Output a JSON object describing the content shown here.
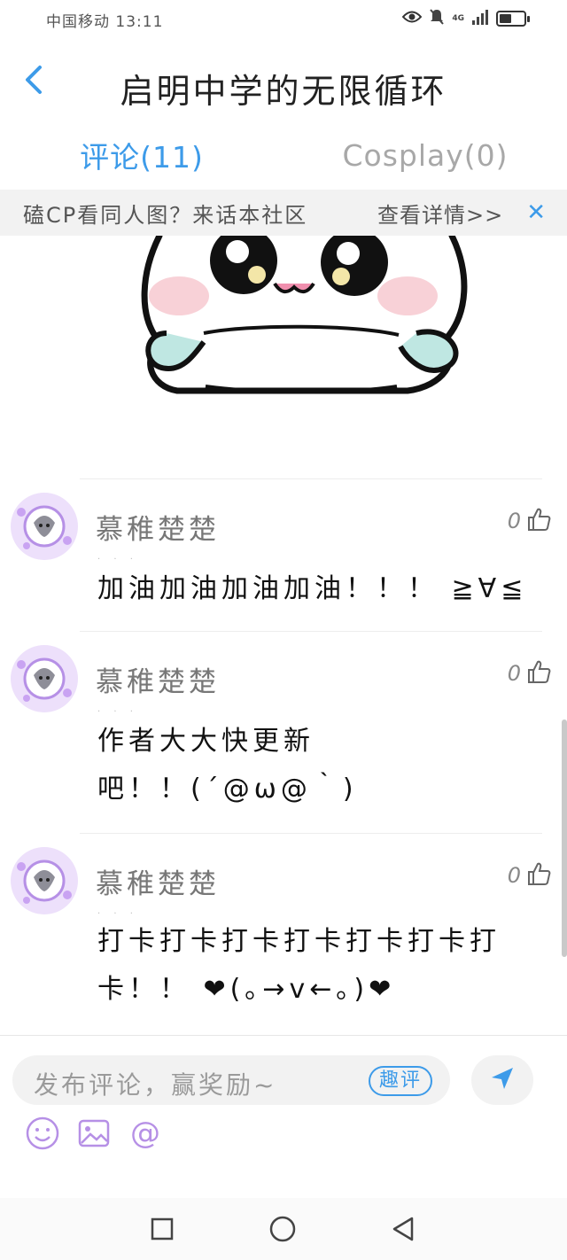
{
  "status_bar": {
    "carrier_time": "中国移动 13:11",
    "network": "4G",
    "battery_level": 0.5,
    "icons": [
      "eye-icon",
      "mute-bell-icon",
      "signal-icon",
      "battery-icon"
    ]
  },
  "header": {
    "title": "启明中学的无限循环",
    "back_icon": "chevron-left-icon"
  },
  "tabs": [
    {
      "label": "评论(11)",
      "active": true
    },
    {
      "label": "Cosplay(0)",
      "active": false
    }
  ],
  "banner": {
    "promo_text": "磕CP看同人图？来话本社区",
    "link_text": "查看详情>>",
    "close_icon": "close-icon"
  },
  "comments": [
    {
      "username": "慕稚楚楚",
      "likes": "0",
      "text": "加油加油加油加油！！！ ≧∀≦"
    },
    {
      "username": "慕稚楚楚",
      "likes": "0",
      "text": "作者大大快更新吧！！(´@ω@｀)"
    },
    {
      "username": "慕稚楚楚",
      "likes": "0",
      "text": "打卡打卡打卡打卡打卡打卡打卡！！ ❤(｡→v←｡)❤"
    }
  ],
  "input": {
    "placeholder": "发布评论，赢奖励~",
    "quping_label": "趣评",
    "send_icon": "send-icon",
    "tools": [
      "emoji-icon",
      "image-icon",
      "at-icon"
    ]
  },
  "colors": {
    "accent": "#3d9be9",
    "avatar_purple": "#b690e6",
    "heart": "#e02a2a"
  },
  "nav": [
    "square-icon",
    "circle-icon",
    "triangle-back-icon"
  ]
}
